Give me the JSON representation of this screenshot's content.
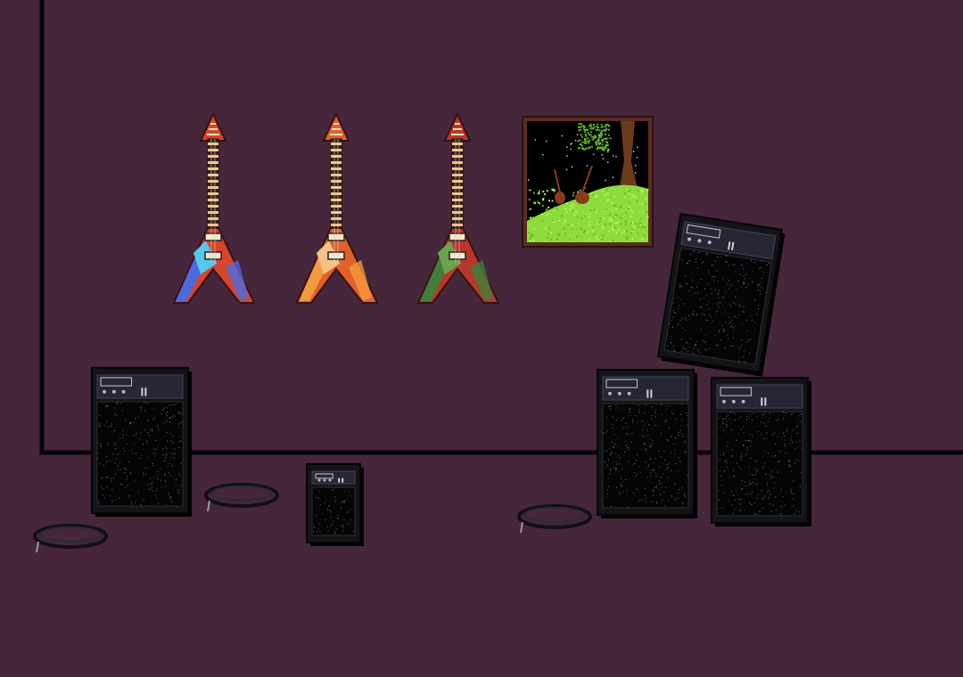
{
  "scene": {
    "colors": {
      "wall": "#45263b",
      "floor": "#45263b",
      "outline": "#050507",
      "amp_body": "#141418",
      "amp_panel": "#262635",
      "amp_grille": "#050506",
      "speckle": "#8f8f9a",
      "cable": "#101014",
      "frame": "#5a2c24",
      "night_sky": "#000000",
      "grass": "#8edc3b",
      "moon": "#b6c6d8",
      "tree_trunk": "#6b3a1c"
    },
    "guitars": [
      {
        "name": "blue-red",
        "body": "#d5452b",
        "accent": "#4a6be0",
        "highlight": "#58c8ea",
        "neck": "#f1c48a"
      },
      {
        "name": "orange",
        "body": "#e0612d",
        "accent": "#f29a3c",
        "highlight": "#f5c189",
        "neck": "#f1c48a"
      },
      {
        "name": "green-red",
        "body": "#b8372a",
        "accent": "#3f7f3a",
        "highlight": "#6aa24e",
        "neck": "#f1c48a"
      }
    ],
    "amps_count": 5,
    "cables_count": 3
  }
}
